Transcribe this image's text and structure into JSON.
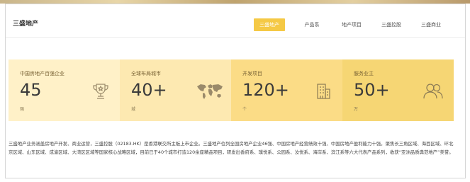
{
  "header": {
    "brand": "三盛地产",
    "nav": [
      "三盛地产",
      "产品系",
      "地产项目",
      "三盛控股",
      "三盛商业"
    ]
  },
  "stats": [
    {
      "label": "中国房地产百强企业",
      "value": "45",
      "unit": "强",
      "icon": "trophy-icon"
    },
    {
      "label": "全球布局城市",
      "value": "40+",
      "unit": "城",
      "icon": "world-map-icon"
    },
    {
      "label": "开发项目",
      "value": "120+",
      "unit": "个",
      "icon": "building-icon"
    },
    {
      "label": "服务业主",
      "value": "50+",
      "unit": "万",
      "icon": "users-icon"
    }
  ],
  "description": "三盛地产业务涵盖房地产开发、商业运营，三盛控股（02183.HK）是香港联交所主板上市企业。三盛地产位列全国房地产企业46强、中国房地产经营绩效十强、中国房地产盈利能力十强，聚焦长三角区域、海西区域、环北京区域、山东区域、成渝区域、大湾区区域等国家核心战略区域，目前已于40个城市打造120余座精品项目，研发出香府系、璞悦系、公园系、汝悦系、海岸系、滨江系等六大代表产品系列，收获“亚洲品质典范地产”美誉。",
  "colors": {
    "accent": "#f5c945",
    "card1": "#fff1c8",
    "card2": "#fde9b1",
    "card3": "#fbdc86",
    "card4": "#f6d674"
  }
}
